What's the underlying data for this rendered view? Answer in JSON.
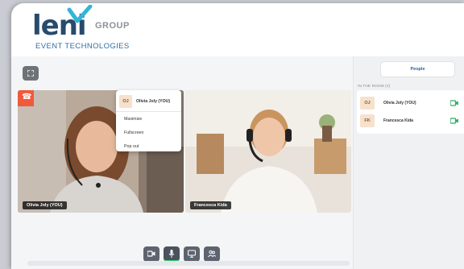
{
  "brand": {
    "logo_word": "leni",
    "logo_group": "GROUP",
    "logo_subtitle": "EVENT TECHNOLOGIES"
  },
  "tiles": [
    {
      "name_tag": "Olivia Joly  (YOU)"
    },
    {
      "name_tag": "Francesca Kida"
    }
  ],
  "context_menu": {
    "initials": "OJ",
    "name": "Olivia Joly  (YOU)",
    "items": [
      "Maximize",
      "Fullscreen",
      "Pop out"
    ]
  },
  "sidebar": {
    "tab_label": "People",
    "room_label": "IN THE ROOM (2)",
    "people": [
      {
        "initials": "OJ",
        "name": "Olivia Joly  (YOU)",
        "camera": "camera-on-icon"
      },
      {
        "initials": "FK",
        "name": "Francesca Kida",
        "camera": "camera-on-icon"
      }
    ]
  },
  "toolbar": {
    "buttons": [
      "video-camera-icon",
      "microphone-icon",
      "screen-share-icon",
      "participants-icon"
    ]
  },
  "colors": {
    "accent_blue": "#2f6fa5",
    "hangup": "#ee5a3b",
    "active_indicator": "#2ecc71",
    "camera_on": "#27ae60"
  }
}
